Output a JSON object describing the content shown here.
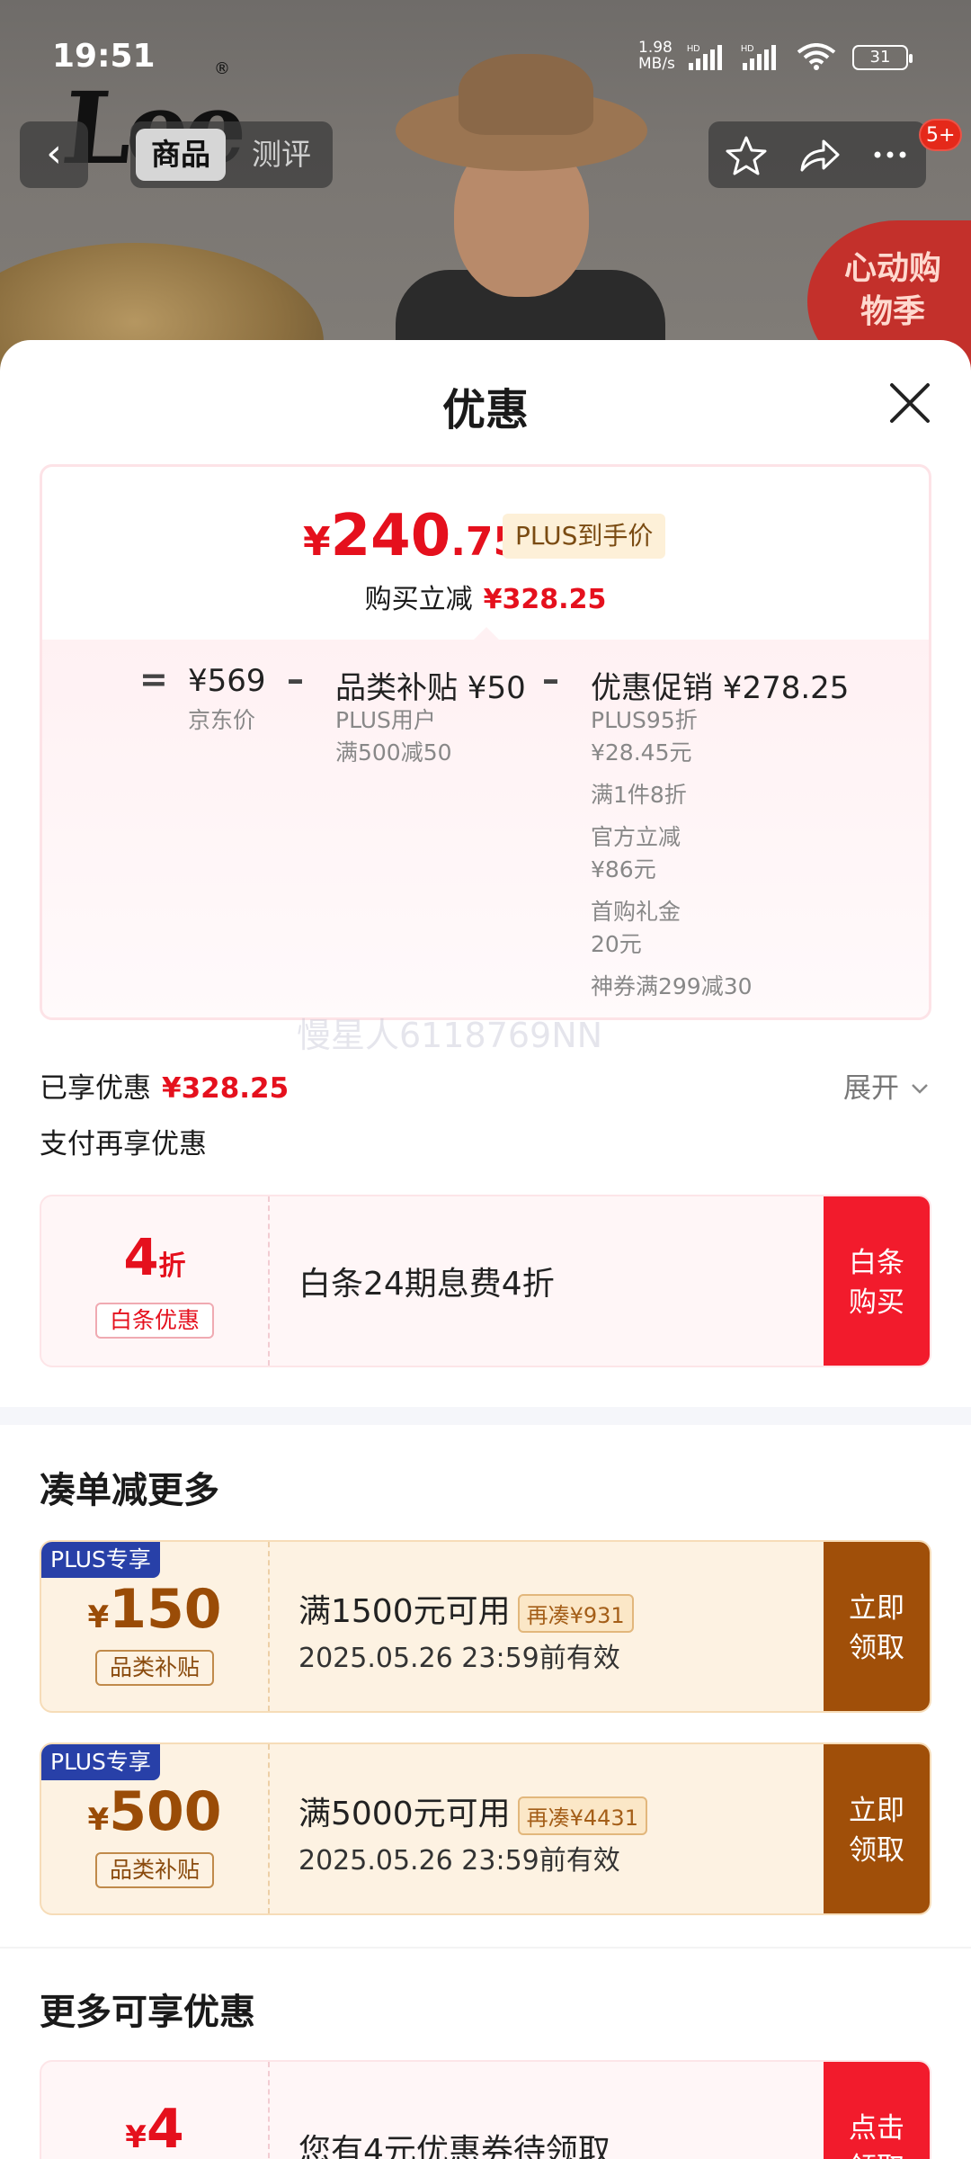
{
  "status_bar": {
    "time": "19:51",
    "net_speed_value": "1.98",
    "net_speed_unit": "MB/s",
    "hd1": "HD",
    "hd2": "HD",
    "battery": "31"
  },
  "header": {
    "brand_logo": "Lee",
    "brand_reg": "®",
    "back_icon": "chevron-left-icon",
    "tabs": [
      {
        "label": "商品",
        "active": true
      },
      {
        "label": "测评",
        "active": false
      }
    ],
    "actions": [
      "star-icon",
      "share-icon",
      "more-icon"
    ],
    "message_badge": "5+",
    "promo_corner": "心动购物季"
  },
  "sheet": {
    "title": "优惠",
    "close_icon": "close-icon"
  },
  "price_card": {
    "currency": "¥",
    "price_int": "240",
    "price_dec": ".75",
    "plus_tag": "PLUS到手价",
    "reduce_label": "购买立减",
    "reduce_amount": "¥328.25",
    "eq": "=",
    "minus": "–",
    "breakdown": [
      {
        "amount": "¥569",
        "sub": [
          "京东价"
        ]
      },
      {
        "amount": "品类补贴 ¥50",
        "sub": [
          "PLUS用户",
          "满500减50"
        ]
      },
      {
        "amount": "优惠促销 ¥278.25",
        "sub": [
          "PLUS95折",
          "¥28.45元",
          "满1件8折",
          "官方立减",
          "¥86元",
          "首购礼金",
          "20元",
          "神券满299减30"
        ]
      }
    ]
  },
  "watermark": "慢星人6118769NN",
  "enjoyed": {
    "label": "已享优惠",
    "amount": "¥328.25",
    "expand_label": "展开"
  },
  "pay_more": {
    "label": "支付再享优惠",
    "coupon": {
      "discount": "4",
      "discount_unit": "折",
      "tag": "白条优惠",
      "desc": "白条24期息费4折",
      "button": [
        "白条",
        "购买"
      ]
    }
  },
  "bundle": {
    "title": "凑单减更多",
    "coupons": [
      {
        "ribbon": "PLUS专享",
        "currency": "¥",
        "amount": "150",
        "tag": "品类补贴",
        "condition": "满1500元可用",
        "note": "再凑¥931",
        "validity": "2025.05.26 23:59前有效",
        "button": [
          "立即",
          "领取"
        ]
      },
      {
        "ribbon": "PLUS专享",
        "currency": "¥",
        "amount": "500",
        "tag": "品类补贴",
        "condition": "满5000元可用",
        "note": "再凑¥4431",
        "validity": "2025.05.26 23:59前有效",
        "button": [
          "立即",
          "领取"
        ]
      }
    ]
  },
  "more": {
    "title": "更多可享优惠",
    "coupon": {
      "currency": "¥",
      "amount": "4",
      "desc": "您有4元优惠券待领取",
      "button": [
        "点击",
        "领取"
      ]
    }
  },
  "colors": {
    "accent_red": "#e5101d",
    "button_red": "#f21b2c",
    "button_brown": "#a04f09",
    "plus_blue": "#2840a8"
  }
}
